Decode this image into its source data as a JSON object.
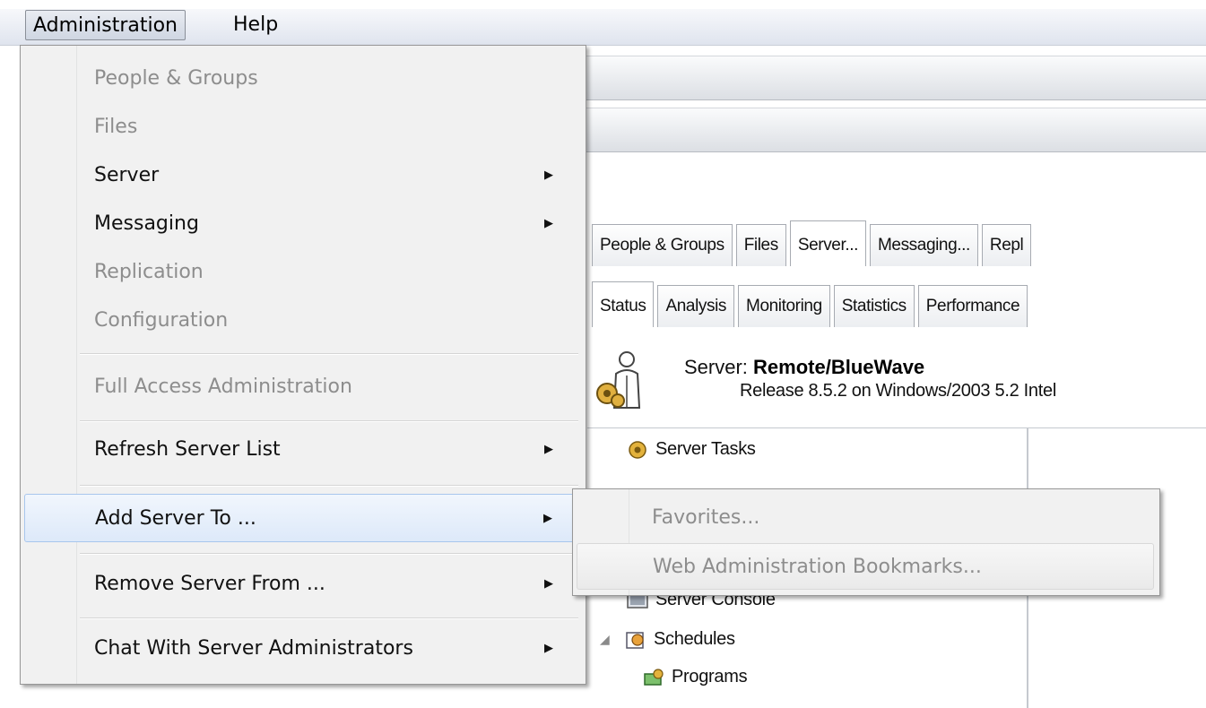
{
  "menubar": {
    "items": [
      {
        "label": "Administration",
        "active": true
      },
      {
        "label": "Help",
        "active": false
      }
    ]
  },
  "admin_menu": {
    "items": [
      {
        "label": "People & Groups",
        "enabled": false,
        "submenu": false
      },
      {
        "label": "Files",
        "enabled": false,
        "submenu": false
      },
      {
        "label": "Server",
        "enabled": true,
        "submenu": true
      },
      {
        "label": "Messaging",
        "enabled": true,
        "submenu": true
      },
      {
        "label": "Replication",
        "enabled": false,
        "submenu": false
      },
      {
        "label": "Configuration",
        "enabled": false,
        "submenu": false
      },
      {
        "label": "Full Access Administration",
        "enabled": false,
        "submenu": false
      },
      {
        "label": "Refresh Server List",
        "enabled": true,
        "submenu": true
      },
      {
        "label": "Add Server To ...",
        "enabled": true,
        "submenu": true,
        "highlighted": true
      },
      {
        "label": "Remove Server From ...",
        "enabled": true,
        "submenu": true
      },
      {
        "label": "Chat With Server Administrators",
        "enabled": true,
        "submenu": true
      }
    ]
  },
  "add_server_submenu": {
    "items": [
      {
        "label": "Favorites...",
        "enabled": false
      },
      {
        "label": "Web Administration Bookmarks...",
        "enabled": false
      }
    ]
  },
  "tabs": {
    "top": [
      "People & Groups",
      "Files",
      "Server...",
      "Messaging...",
      "Repl"
    ],
    "top_selected": "Server...",
    "sub": [
      "Status",
      "Analysis",
      "Monitoring",
      "Statistics",
      "Performance"
    ],
    "sub_selected": "Status"
  },
  "server": {
    "prefix": "Server:",
    "name": "Remote/BlueWave",
    "release": "Release 8.5.2 on Windows/2003 5.2 Intel"
  },
  "tree": {
    "items": [
      {
        "label": "Server Tasks",
        "icon": "server-tasks-icon"
      },
      {
        "label": "Server Console",
        "icon": "console-icon"
      },
      {
        "label": "Schedules",
        "icon": "schedules-icon"
      },
      {
        "label": "Programs",
        "icon": "programs-icon"
      }
    ]
  },
  "colors": {
    "menu_bg": "#f1f1f1",
    "disabled_text": "#8d8d8d",
    "highlight_border": "#a8c6ed"
  }
}
